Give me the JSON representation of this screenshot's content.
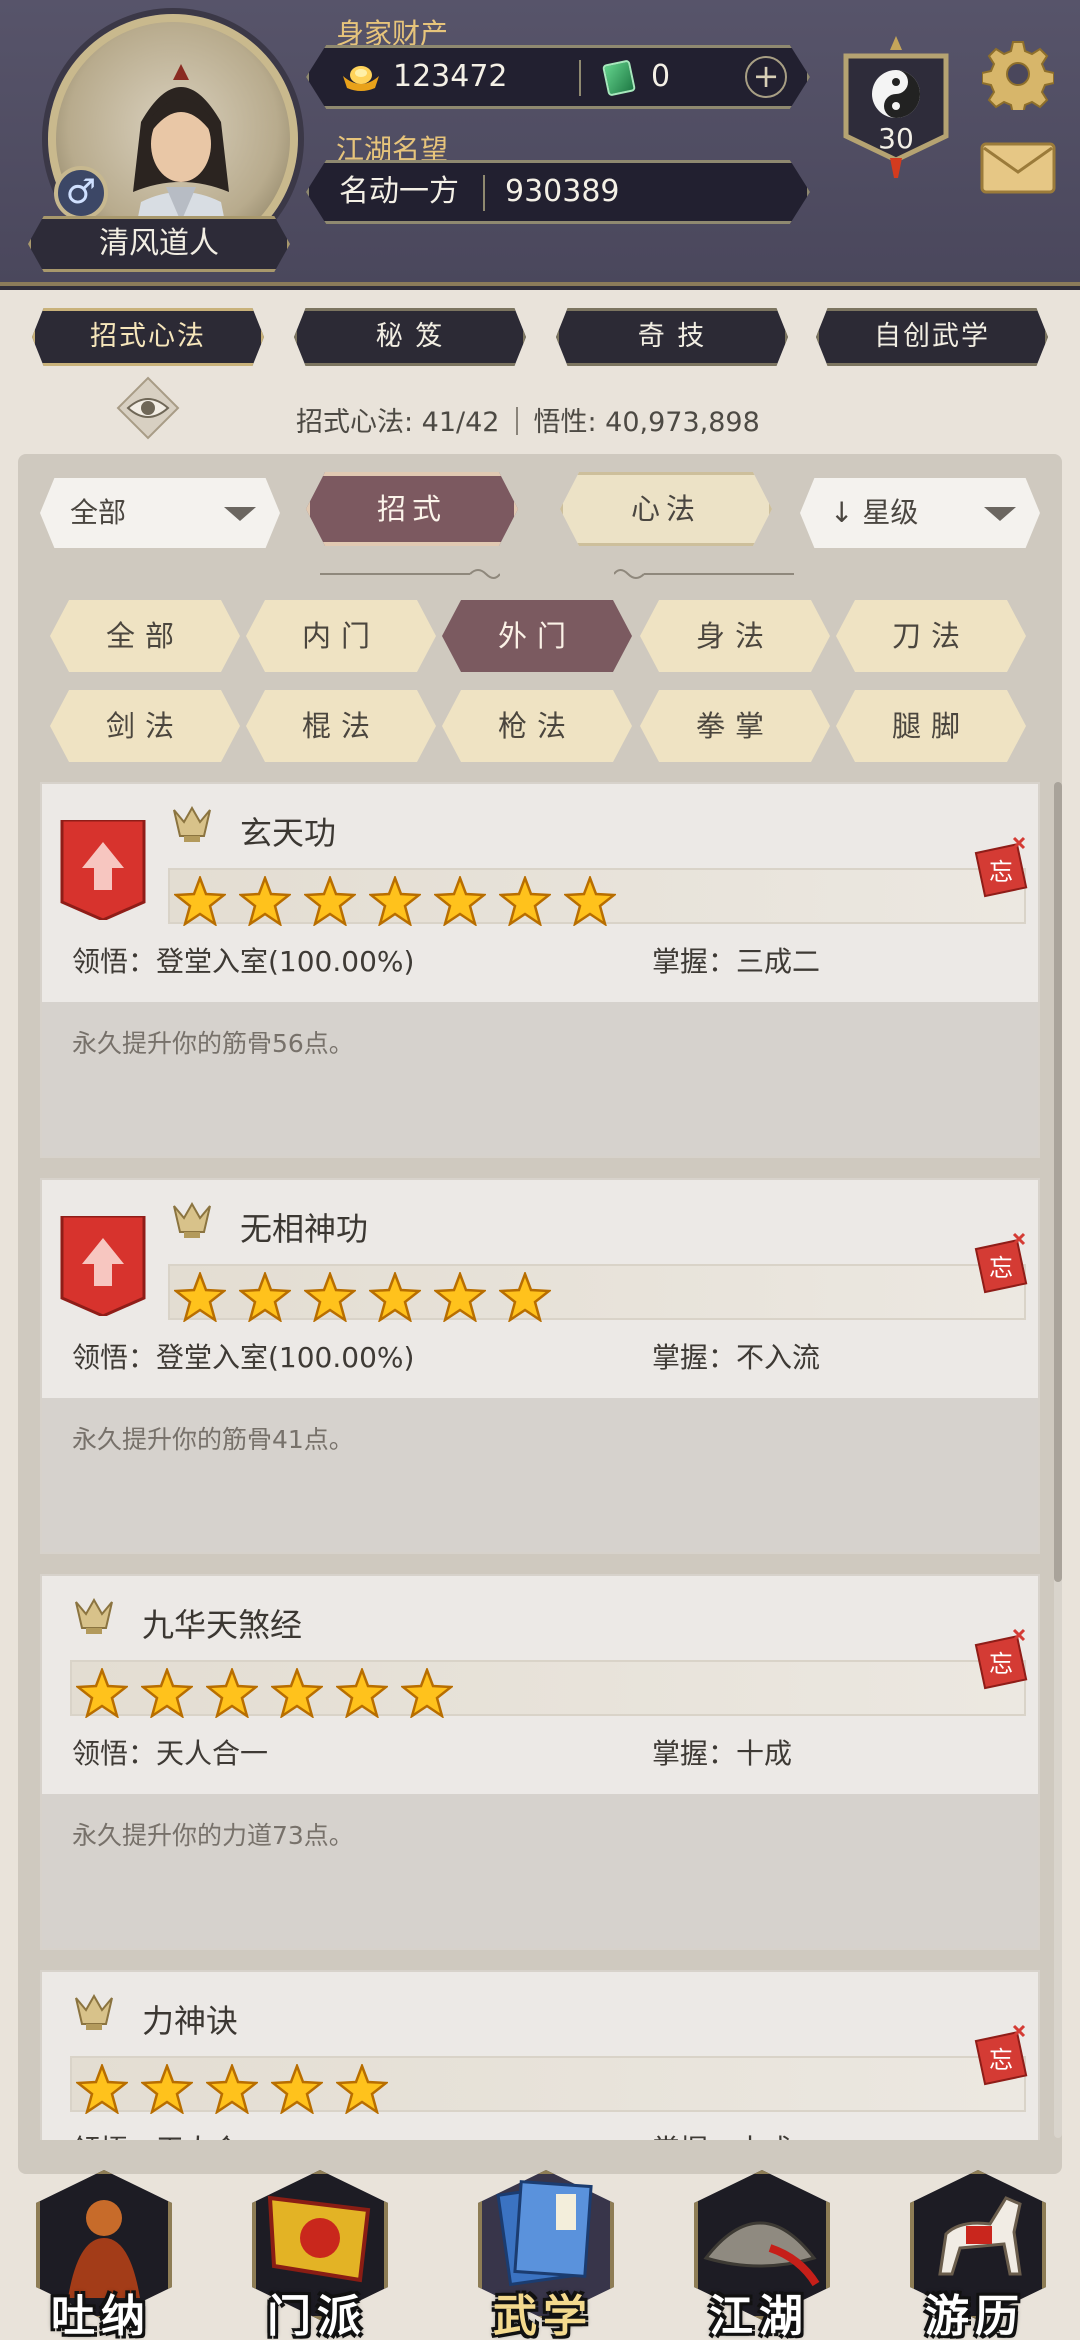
{
  "header": {
    "player_name": "清风道人",
    "gender_symbol": "♂",
    "wealth_label": "身家财产",
    "gold": "123472",
    "jade": "0",
    "plus": "+",
    "fame_label": "江湖名望",
    "fame_title": "名动一方",
    "fame_value": "930389",
    "level": "30"
  },
  "main_tabs": [
    {
      "label": "招式心法",
      "active": true
    },
    {
      "label": "秘 笈",
      "active": false
    },
    {
      "label": "奇 技",
      "active": false
    },
    {
      "label": "自创武学",
      "active": false
    }
  ],
  "stats": {
    "skills_label": "招式心法: 41/42",
    "insight_label": "悟性: 40,973,898"
  },
  "controls": {
    "category_dropdown": "全部",
    "sort_dropdown": "星级",
    "sort_arrow": "↓",
    "seg_skill": "招式",
    "seg_heart": "心法"
  },
  "filters": [
    {
      "label": "全部",
      "active": false
    },
    {
      "label": "内门",
      "active": false
    },
    {
      "label": "外门",
      "active": true
    },
    {
      "label": "身法",
      "active": false
    },
    {
      "label": "刀法",
      "active": false
    },
    {
      "label": "剑法",
      "active": false
    },
    {
      "label": "棍法",
      "active": false
    },
    {
      "label": "枪法",
      "active": false
    },
    {
      "label": "拳掌",
      "active": false
    },
    {
      "label": "腿脚",
      "active": false
    }
  ],
  "skills": [
    {
      "name": "玄天功",
      "stars": 7,
      "banner": true,
      "comprehension": "领悟：登堂入室(100.00%)",
      "mastery": "掌握：三成二",
      "desc": "永久提升你的筋骨56点。"
    },
    {
      "name": "无相神功",
      "stars": 6,
      "banner": true,
      "comprehension": "领悟：登堂入室(100.00%)",
      "mastery": "掌握：不入流",
      "desc": "永久提升你的筋骨41点。"
    },
    {
      "name": "九华天煞经",
      "stars": 6,
      "banner": false,
      "comprehension": "领悟：天人合一",
      "mastery": "掌握：十成",
      "desc": "永久提升你的力道73点。"
    },
    {
      "name": "力神诀",
      "stars": 5,
      "banner": false,
      "comprehension": "领悟：天人合一",
      "mastery": "掌握：十成",
      "desc": ""
    }
  ],
  "forget_tag": "忘",
  "bottom_nav": [
    {
      "label": "吐纳",
      "icon": "monk-icon",
      "active": false
    },
    {
      "label": "门派",
      "icon": "sect-flag-icon",
      "active": false
    },
    {
      "label": "武学",
      "icon": "martial-book-icon",
      "active": true
    },
    {
      "label": "江湖",
      "icon": "straw-hat-icon",
      "active": false
    },
    {
      "label": "游历",
      "icon": "horse-icon",
      "active": false
    }
  ]
}
